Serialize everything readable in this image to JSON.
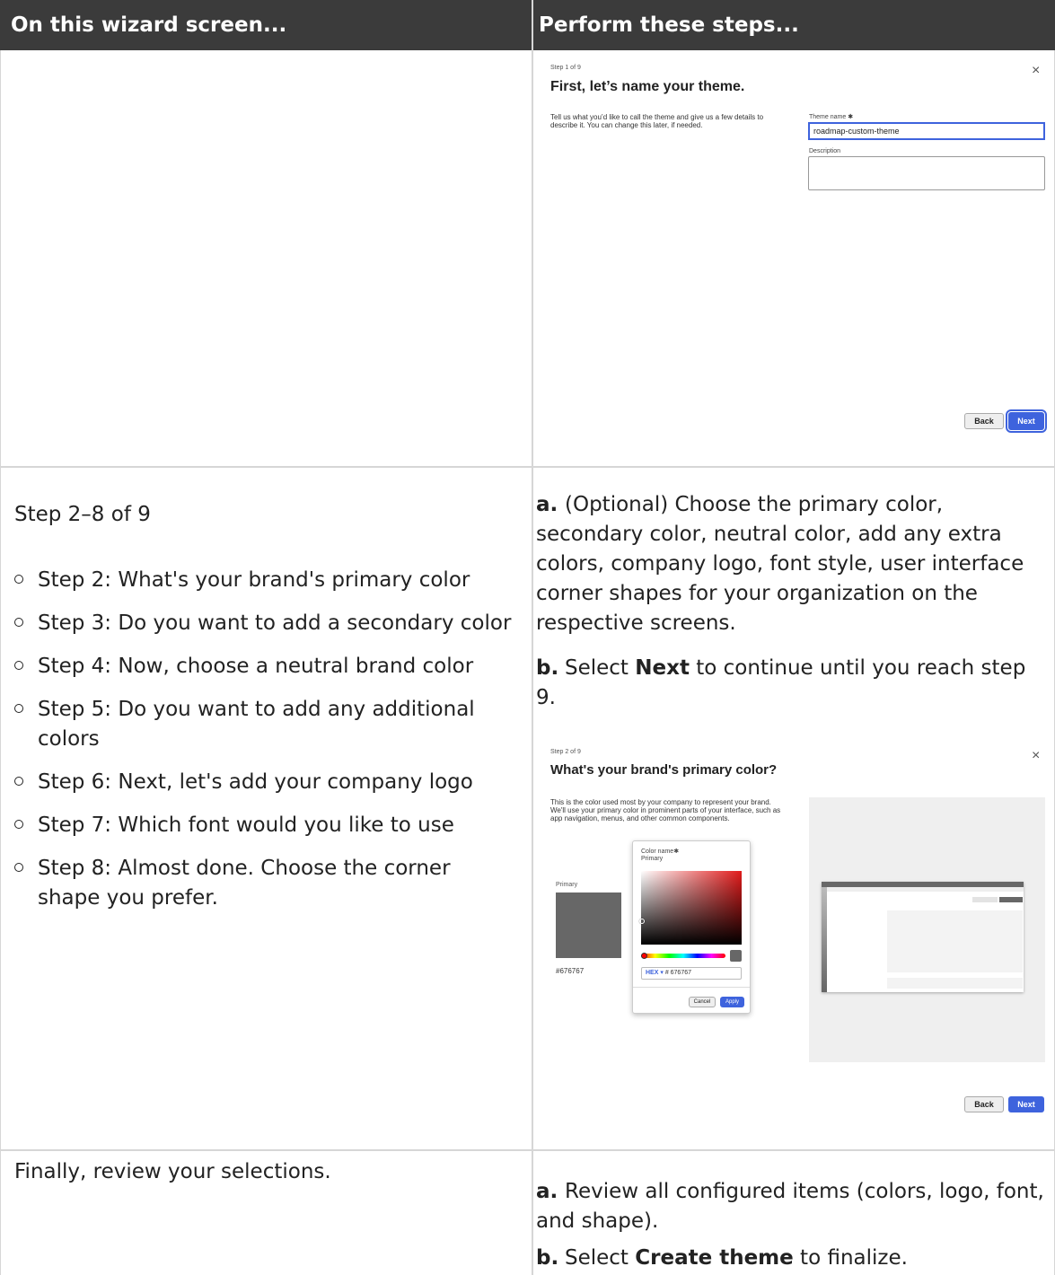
{
  "header": {
    "left": "On this wizard screen...",
    "right": "Perform these steps..."
  },
  "wizard1": {
    "step": "Step 1 of 9",
    "title": "First, let’s name your theme.",
    "description": "Tell us what you’d like to call the theme and give us a few details to describe it. You can change this later, if needed.",
    "theme_name_label": "Theme name",
    "theme_name_value": "roadmap-custom-theme",
    "description_label": "Description",
    "back": "Back",
    "next": "Next",
    "close": "×"
  },
  "row2": {
    "step_range": "Step 2–8 of 9",
    "steps": [
      "Step 2: What's your brand's primary color",
      "Step 3: Do you want to add a secondary color",
      "Step 4: Now, choose a neutral brand color",
      "Step 5: Do you want to add any additional colors",
      "Step 6: Next, let's add your company logo",
      "Step 7: Which font would you like to use",
      "Step 8: Almost done. Choose the corner shape you prefer."
    ],
    "instr_a_letter": "a.",
    "instr_a": "(Optional) Choose the primary color, secondary color, neutral color, add any extra colors, company logo, font style, user interface corner shapes for your organization on the respective screens.",
    "instr_b_letter": "b.",
    "instr_b_pre": "Select ",
    "instr_b_bold": "Next",
    "instr_b_post": " to continue until you reach step 9."
  },
  "wizard2": {
    "step": "Step 2 of 9",
    "title": "What's your brand's primary color?",
    "description": "This is the color used most by your company to represent your brand. We'll use your primary color in prominent parts of your interface, such as app navigation, menus, and other common components.",
    "swatch_label": "Primary",
    "swatch_hex": "#676767",
    "picker_color_name_label": "Color name",
    "picker_color_name_value": "Primary",
    "picker_format": "HEX",
    "picker_hex": "# 676767",
    "picker_cancel": "Cancel",
    "picker_apply": "Apply",
    "back": "Back",
    "next": "Next",
    "close": "×",
    "swatch_color": "#676767"
  },
  "row3": {
    "text": "Finally, review your selections.",
    "instr_a_letter": "a.",
    "instr_a": "Review all configured items (colors, logo, font, and shape).",
    "instr_b_letter": "b.",
    "instr_b_pre": "Select ",
    "instr_b_bold": "Create theme",
    "instr_b_post": " to finalize."
  }
}
